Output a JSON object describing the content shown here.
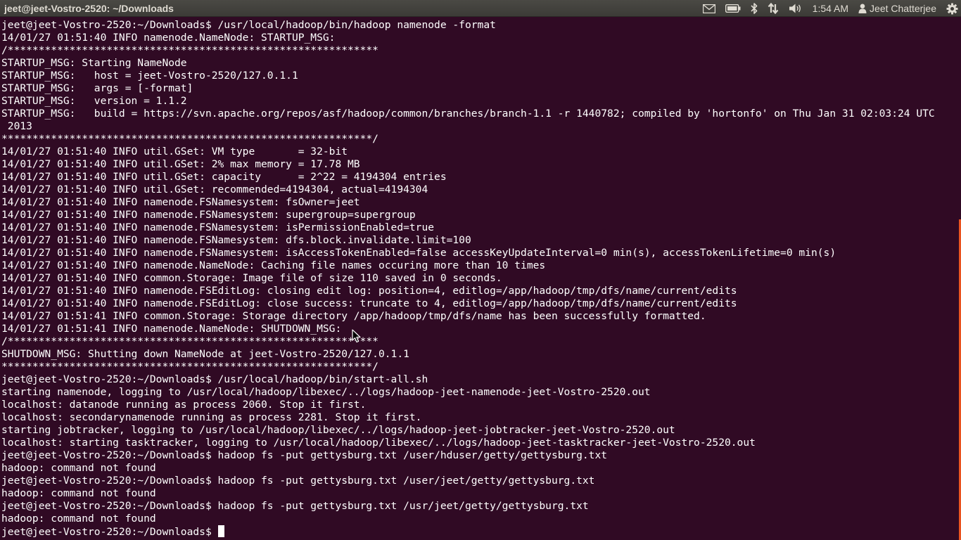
{
  "topbar": {
    "window_title": "jeet@jeet-Vostro-2520: ~/Downloads",
    "indicators": {
      "mail_icon": "mail-icon",
      "battery_icon": "battery-icon",
      "bluetooth_icon": "bluetooth-icon",
      "network_icon": "network-icon",
      "volume_icon": "volume-icon",
      "clock": "1:54 AM",
      "user_icon": "user-icon",
      "user_name": "Jeet Chatterjee",
      "settings_icon": "gear-icon"
    }
  },
  "terminal": {
    "background_color": "#300a24",
    "text_color": "#ffffff",
    "lines": [
      "jeet@jeet-Vostro-2520:~/Downloads$ /usr/local/hadoop/bin/hadoop namenode -format",
      "14/01/27 01:51:40 INFO namenode.NameNode: STARTUP_MSG:",
      "/************************************************************",
      "STARTUP_MSG: Starting NameNode",
      "STARTUP_MSG:   host = jeet-Vostro-2520/127.0.1.1",
      "STARTUP_MSG:   args = [-format]",
      "STARTUP_MSG:   version = 1.1.2",
      "STARTUP_MSG:   build = https://svn.apache.org/repos/asf/hadoop/common/branches/branch-1.1 -r 1440782; compiled by 'hortonfo' on Thu Jan 31 02:03:24 UTC",
      " 2013",
      "************************************************************/",
      "14/01/27 01:51:40 INFO util.GSet: VM type       = 32-bit",
      "14/01/27 01:51:40 INFO util.GSet: 2% max memory = 17.78 MB",
      "14/01/27 01:51:40 INFO util.GSet: capacity      = 2^22 = 4194304 entries",
      "14/01/27 01:51:40 INFO util.GSet: recommended=4194304, actual=4194304",
      "14/01/27 01:51:40 INFO namenode.FSNamesystem: fsOwner=jeet",
      "14/01/27 01:51:40 INFO namenode.FSNamesystem: supergroup=supergroup",
      "14/01/27 01:51:40 INFO namenode.FSNamesystem: isPermissionEnabled=true",
      "14/01/27 01:51:40 INFO namenode.FSNamesystem: dfs.block.invalidate.limit=100",
      "14/01/27 01:51:40 INFO namenode.FSNamesystem: isAccessTokenEnabled=false accessKeyUpdateInterval=0 min(s), accessTokenLifetime=0 min(s)",
      "14/01/27 01:51:40 INFO namenode.NameNode: Caching file names occuring more than 10 times",
      "14/01/27 01:51:40 INFO common.Storage: Image file of size 110 saved in 0 seconds.",
      "14/01/27 01:51:40 INFO namenode.FSEditLog: closing edit log: position=4, editlog=/app/hadoop/tmp/dfs/name/current/edits",
      "14/01/27 01:51:40 INFO namenode.FSEditLog: close success: truncate to 4, editlog=/app/hadoop/tmp/dfs/name/current/edits",
      "14/01/27 01:51:41 INFO common.Storage: Storage directory /app/hadoop/tmp/dfs/name has been successfully formatted.",
      "14/01/27 01:51:41 INFO namenode.NameNode: SHUTDOWN_MSG:",
      "/************************************************************",
      "SHUTDOWN_MSG: Shutting down NameNode at jeet-Vostro-2520/127.0.1.1",
      "************************************************************/",
      "jeet@jeet-Vostro-2520:~/Downloads$ /usr/local/hadoop/bin/start-all.sh",
      "starting namenode, logging to /usr/local/hadoop/libexec/../logs/hadoop-jeet-namenode-jeet-Vostro-2520.out",
      "localhost: datanode running as process 2060. Stop it first.",
      "localhost: secondarynamenode running as process 2281. Stop it first.",
      "starting jobtracker, logging to /usr/local/hadoop/libexec/../logs/hadoop-jeet-jobtracker-jeet-Vostro-2520.out",
      "localhost: starting tasktracker, logging to /usr/local/hadoop/libexec/../logs/hadoop-jeet-tasktracker-jeet-Vostro-2520.out",
      "jeet@jeet-Vostro-2520:~/Downloads$ hadoop fs -put gettysburg.txt /user/hduser/getty/gettysburg.txt",
      "hadoop: command not found",
      "jeet@jeet-Vostro-2520:~/Downloads$ hadoop fs -put gettysburg.txt /user/jeet/getty/gettysburg.txt",
      "hadoop: command not found",
      "jeet@jeet-Vostro-2520:~/Downloads$ hadoop fs -put gettysburg.txt /usr/jeet/getty/gettysburg.txt",
      "hadoop: command not found"
    ],
    "current_prompt": "jeet@jeet-Vostro-2520:~/Downloads$ "
  }
}
